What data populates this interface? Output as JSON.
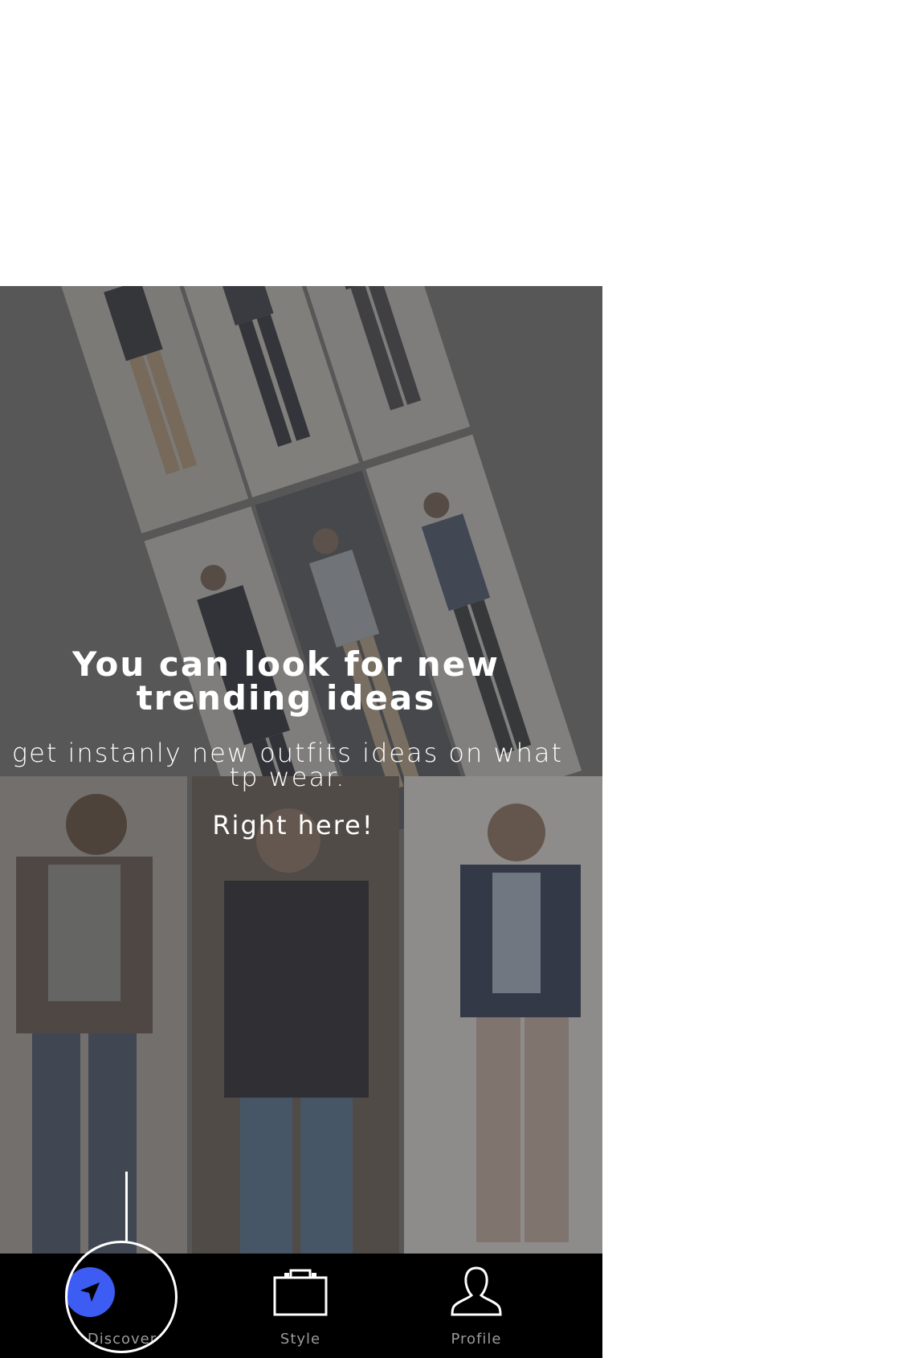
{
  "onboarding": {
    "headline": "You can look for  new trending ideas",
    "subline": "get instanly new outfits ideas on what tp wear.",
    "callout": "Right here!"
  },
  "tabbar": {
    "tabs": [
      {
        "label": "Discover",
        "icon": "navigation-arrow-icon",
        "active": true
      },
      {
        "label": "Style",
        "icon": "briefcase-icon",
        "active": false
      },
      {
        "label": "Profile",
        "icon": "person-icon",
        "active": false
      }
    ]
  },
  "colors": {
    "active_tab": "#3d5cf4",
    "tab_bar_bg": "#000000",
    "overlay": "#6e6e6e",
    "tab_label": "#9a9a9a"
  }
}
